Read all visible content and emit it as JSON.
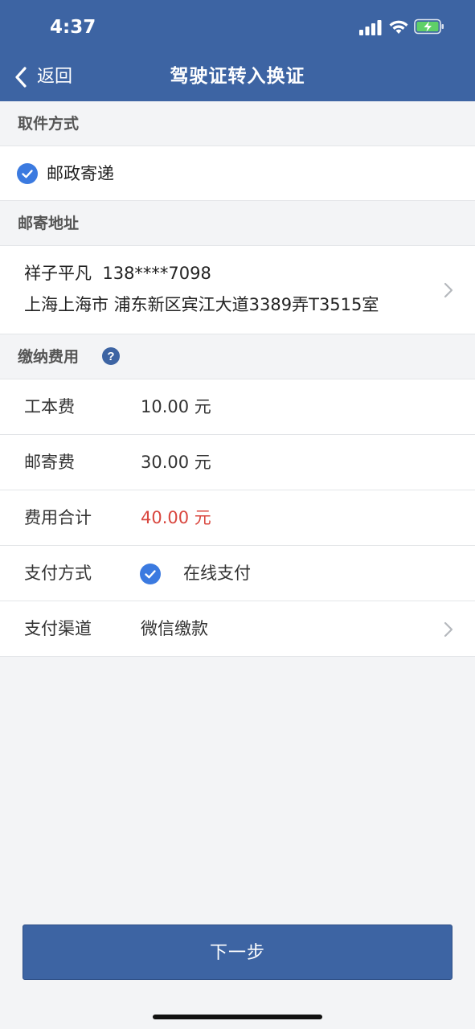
{
  "status_bar": {
    "time": "4:37"
  },
  "nav": {
    "back_label": "返回",
    "title": "驾驶证转入换证"
  },
  "pickup": {
    "section_title": "取件方式",
    "option_label": "邮政寄递"
  },
  "address": {
    "section_title": "邮寄地址",
    "name_phone": "祥子平凡  138****7098",
    "full_address": "上海上海市 浦东新区宾江大道3389弄T3515室"
  },
  "fees": {
    "section_title": "缴纳费用",
    "help_symbol": "?",
    "rows": [
      {
        "label": "工本费",
        "value": "10.00 元"
      },
      {
        "label": "邮寄费",
        "value": "30.00 元"
      },
      {
        "label": "费用合计",
        "value": "40.00 元"
      }
    ],
    "payment_method_label": "支付方式",
    "payment_method_value": "在线支付",
    "payment_channel_label": "支付渠道",
    "payment_channel_value": "微信缴款"
  },
  "footer": {
    "next_label": "下一步"
  },
  "colors": {
    "brand": "#3d64a3",
    "check": "#3b7ae0",
    "total": "#d9473f"
  }
}
